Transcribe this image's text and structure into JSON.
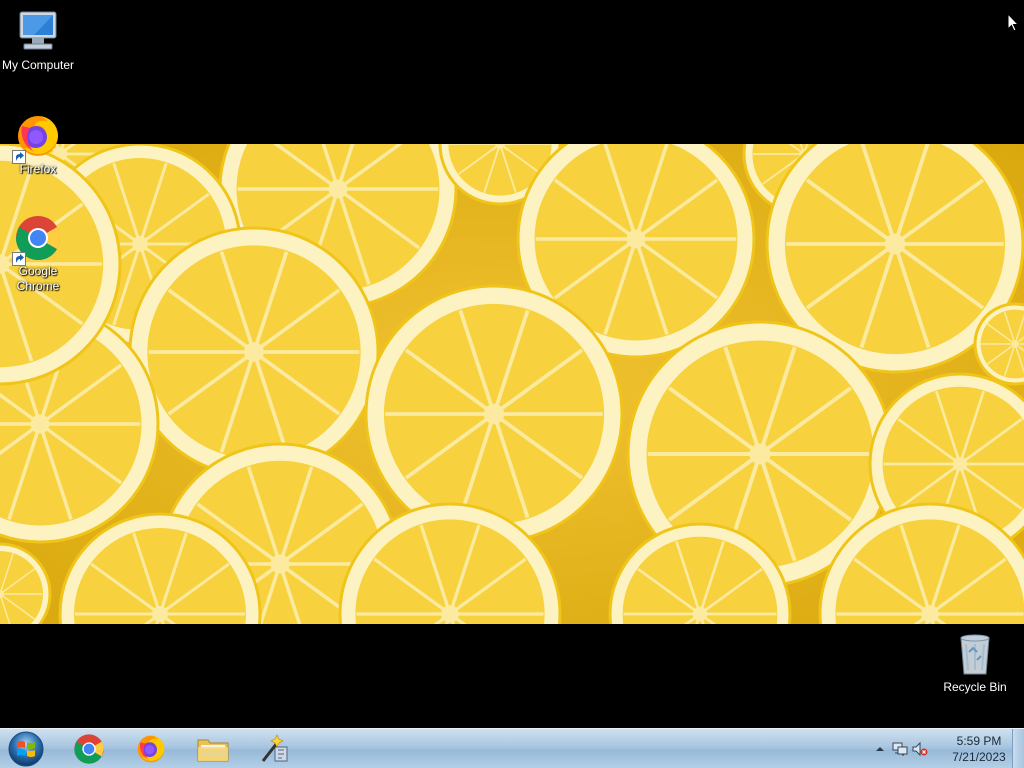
{
  "desktop": {
    "icons": [
      {
        "label": "My Computer",
        "icon": "computer-icon"
      },
      {
        "label": "Firefox",
        "icon": "firefox-icon"
      },
      {
        "label": "Google Chrome",
        "icon": "chrome-icon"
      },
      {
        "label": "Recycle Bin",
        "icon": "recycle-bin-icon"
      }
    ],
    "wallpaper": "lemon-slices"
  },
  "taskbar": {
    "start": {
      "icon": "windows-start-icon"
    },
    "pinned": [
      {
        "name": "Google Chrome",
        "icon": "chrome-icon"
      },
      {
        "name": "Firefox",
        "icon": "firefox-icon"
      },
      {
        "name": "Windows Explorer",
        "icon": "folder-icon"
      },
      {
        "name": "Tool",
        "icon": "wand-tool-icon"
      }
    ],
    "tray": {
      "icons": [
        "show-hidden-icons-chevron",
        "network-icon",
        "volume-muted-icon"
      ],
      "time": "5:59 PM",
      "date": "7/21/2023"
    }
  },
  "colors": {
    "desktop_bg": "#000000",
    "taskbar": "#a9c6e0",
    "lemon": "#f6d243",
    "rind": "#fff6c8"
  }
}
